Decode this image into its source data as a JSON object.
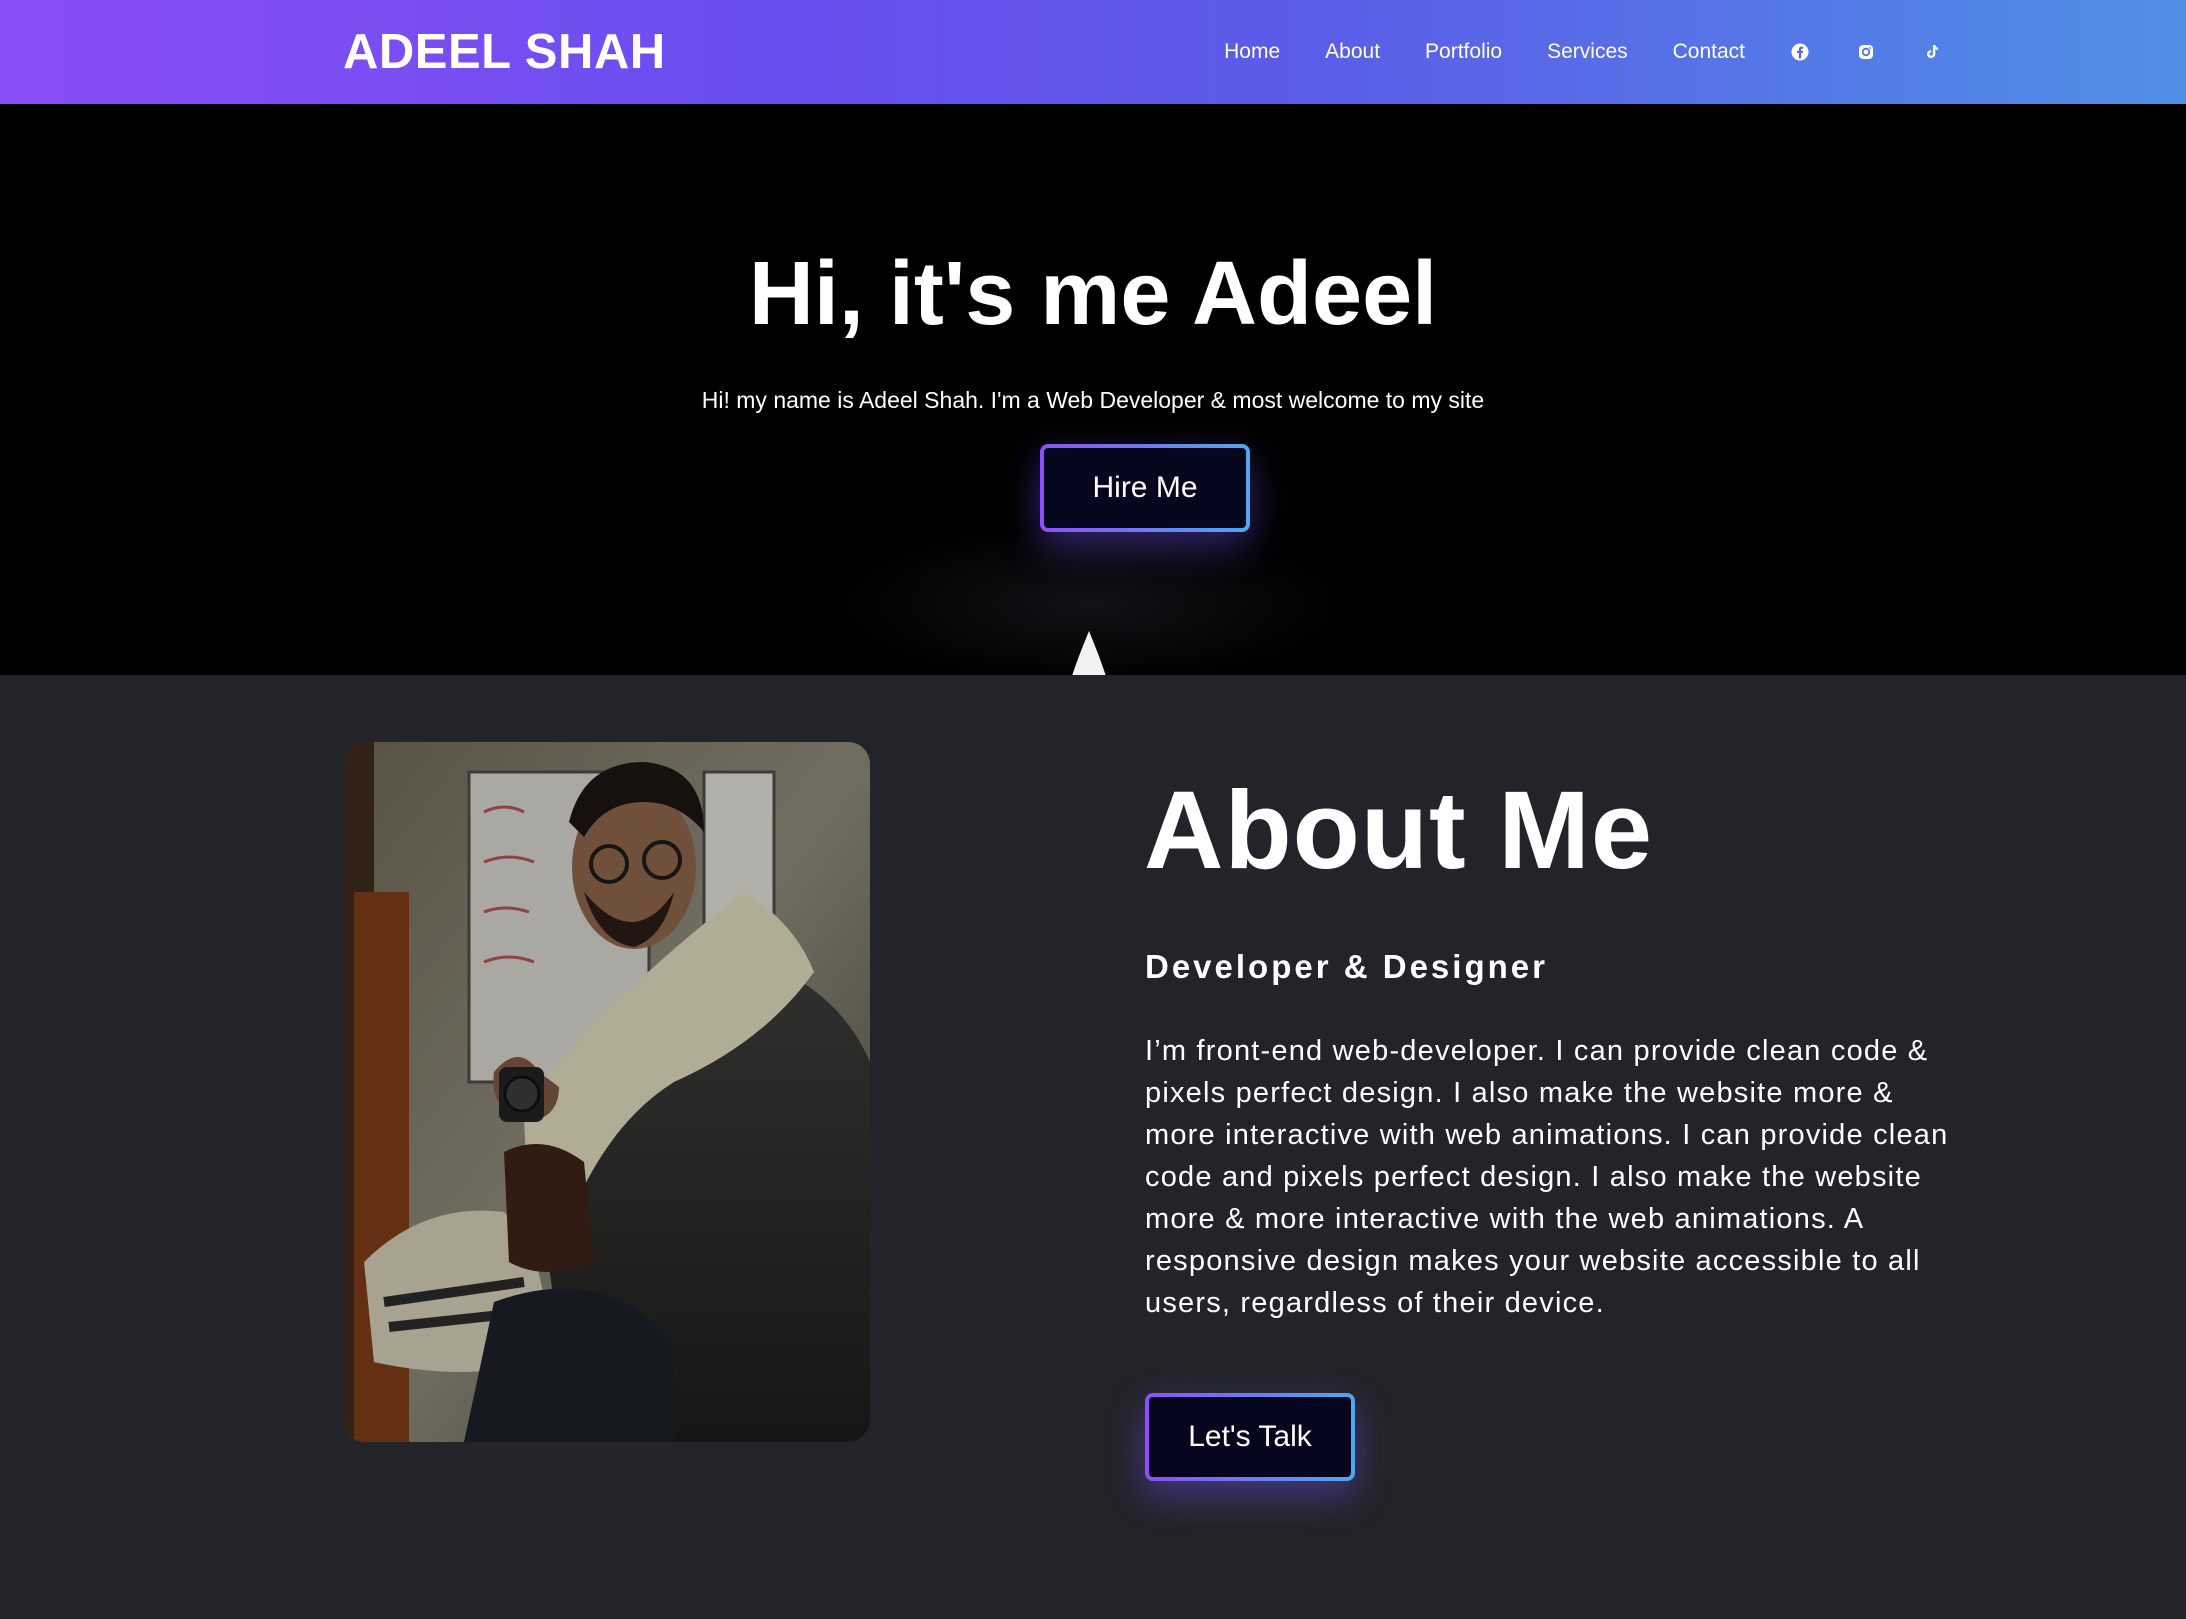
{
  "header": {
    "logo": "ADEEL SHAH",
    "nav": [
      "Home",
      "About",
      "Portfolio",
      "Services",
      "Contact"
    ],
    "social_icons": [
      "facebook-icon",
      "instagram-icon",
      "tiktok-icon"
    ]
  },
  "hero": {
    "title": "Hi, it's me Adeel",
    "subtitle": "Hi! my name is Adeel Shah. I'm a Web Developer & most welcome to my site",
    "button": "Hire Me"
  },
  "about": {
    "title": "About Me",
    "role": "Developer & Designer",
    "text": "I’m front-end web-developer. I can provide clean code & pixels perfect design. I also make the website more & more interactive with web animations. I can provide clean code and pixels perfect design. I also make the website more & more interactive with the web animations. A responsive design makes your website accessible to all users, regardless of their device.",
    "button": "Let's Talk"
  },
  "colors": {
    "header_gradient_start": "#8a4df5",
    "header_gradient_end": "#4f8fe6",
    "hero_bg": "#000000",
    "about_bg": "#222429",
    "button_bg": "#06061e"
  }
}
